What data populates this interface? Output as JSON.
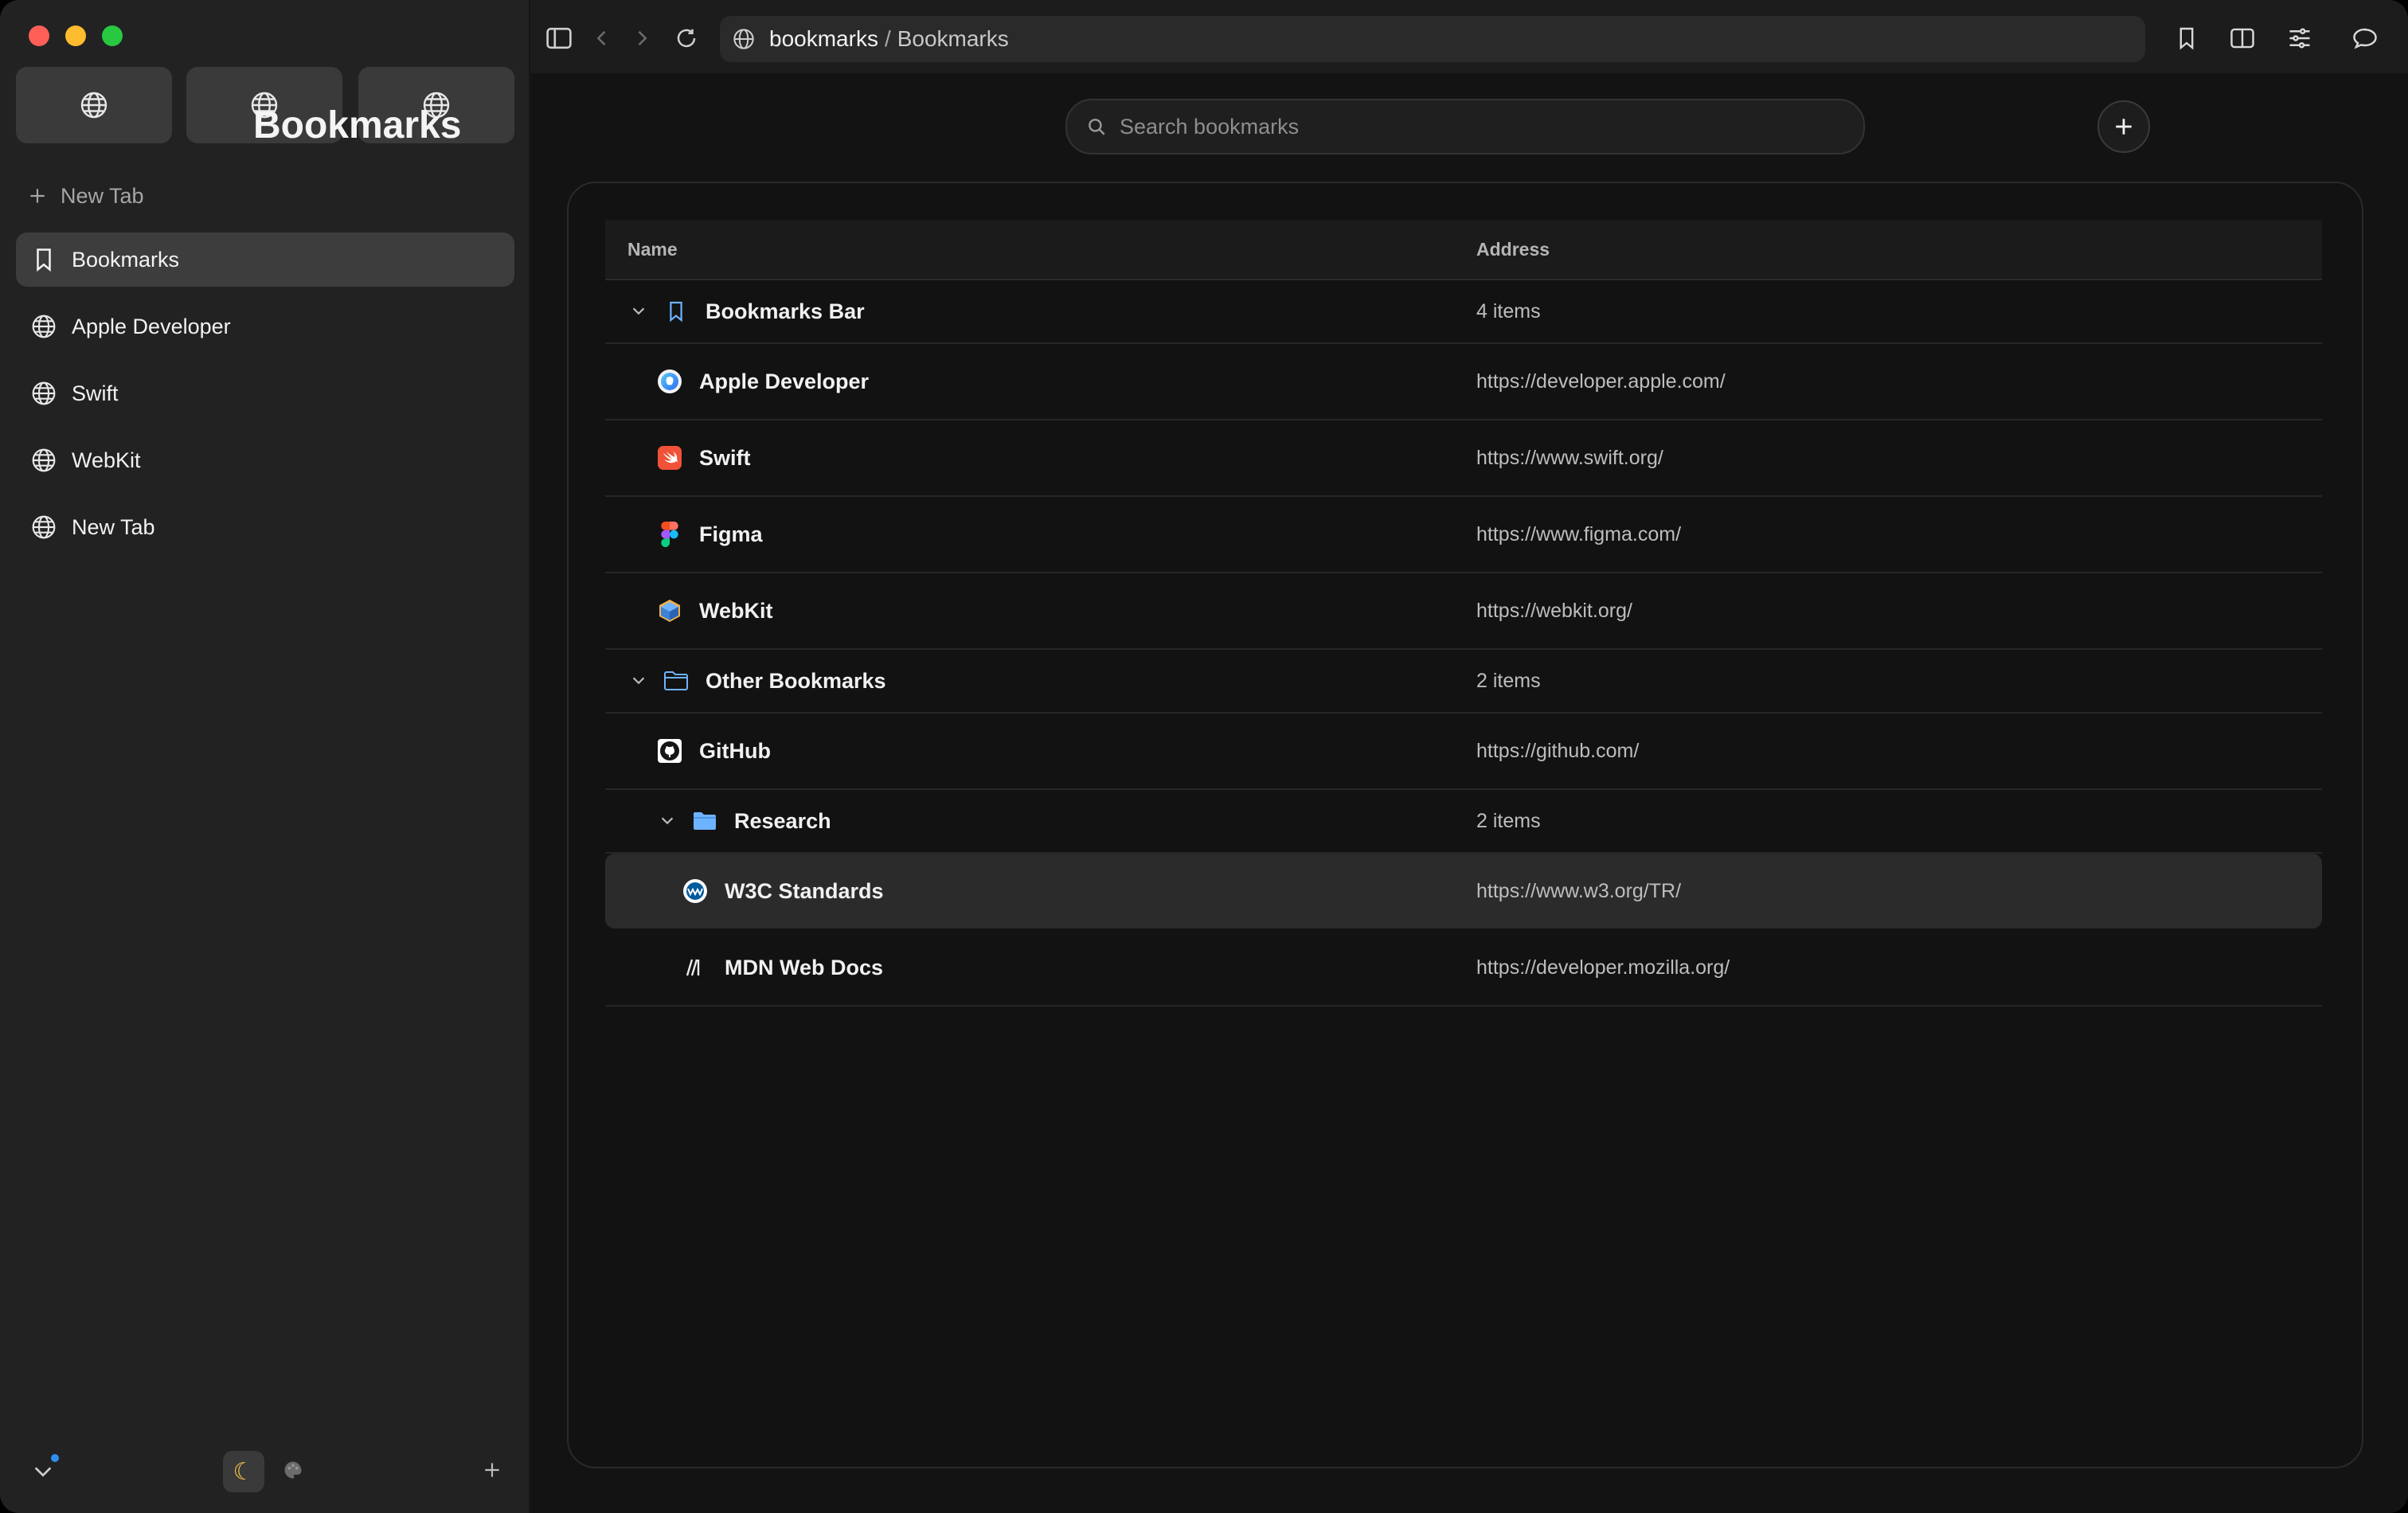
{
  "window": {
    "traffic_colors": {
      "close": "#ff5f57",
      "minimize": "#febc2e",
      "zoom": "#28c840"
    }
  },
  "sidebar": {
    "pinned_tabs": [
      {
        "icon": "globe-icon"
      },
      {
        "icon": "globe-icon"
      },
      {
        "icon": "globe-icon"
      }
    ],
    "new_tab_label": "New Tab",
    "items": [
      {
        "label": "Bookmarks",
        "icon": "bookmark-icon",
        "active": true
      },
      {
        "label": "Apple Developer",
        "icon": "globe-icon"
      },
      {
        "label": "Swift",
        "icon": "globe-icon"
      },
      {
        "label": "WebKit",
        "icon": "globe-icon"
      },
      {
        "label": "New Tab",
        "icon": "globe-icon"
      }
    ],
    "bottom": {
      "left_icon": "checkmark-chevron-icon",
      "theme_icon": "moon-icon",
      "palette_icon": "palette-icon",
      "add_icon": "plus-icon"
    }
  },
  "toolbar": {
    "url_host": "bookmarks",
    "url_separator": "/",
    "url_path": "Bookmarks"
  },
  "page": {
    "title": "Bookmarks",
    "search_placeholder": "Search bookmarks",
    "columns": {
      "name": "Name",
      "address": "Address"
    }
  },
  "bookmarks": {
    "rows": [
      {
        "type": "folder",
        "name": "Bookmarks Bar",
        "address": "4 items",
        "icon": "bookmark-outline-icon"
      },
      {
        "type": "link",
        "name": "Apple Developer",
        "address": "https://developer.apple.com/",
        "icon": "apple-developer-icon"
      },
      {
        "type": "link",
        "name": "Swift",
        "address": "https://www.swift.org/",
        "icon": "swift-icon"
      },
      {
        "type": "link",
        "name": "Figma",
        "address": "https://www.figma.com/",
        "icon": "figma-icon"
      },
      {
        "type": "link",
        "name": "WebKit",
        "address": "https://webkit.org/",
        "icon": "webkit-icon"
      },
      {
        "type": "folder",
        "name": "Other Bookmarks",
        "address": "2 items",
        "icon": "folder-outline-icon"
      },
      {
        "type": "link",
        "name": "GitHub",
        "address": "https://github.com/",
        "icon": "github-icon"
      },
      {
        "type": "folder",
        "name": "Research",
        "address": "2 items",
        "icon": "folder-filled-icon"
      },
      {
        "type": "link",
        "name": "W3C Standards",
        "address": "https://www.w3.org/TR/",
        "icon": "w3c-icon",
        "selected": true
      },
      {
        "type": "link",
        "name": "MDN Web Docs",
        "address": "https://developer.mozilla.org/",
        "icon": "mdn-icon"
      }
    ]
  },
  "colors": {
    "accent": "#2f8ff0",
    "folder_blue": "#6db3ff"
  }
}
